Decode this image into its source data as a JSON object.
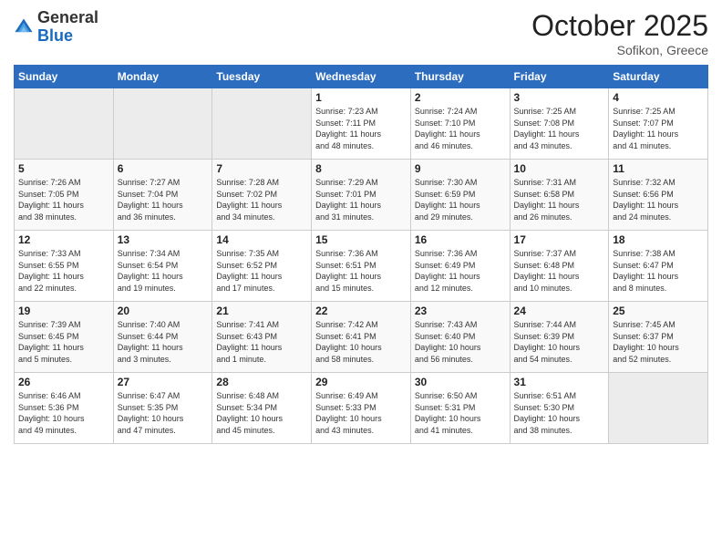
{
  "logo": {
    "general": "General",
    "blue": "Blue"
  },
  "header": {
    "month": "October 2025",
    "location": "Sofikon, Greece"
  },
  "days_of_week": [
    "Sunday",
    "Monday",
    "Tuesday",
    "Wednesday",
    "Thursday",
    "Friday",
    "Saturday"
  ],
  "weeks": [
    [
      {
        "day": "",
        "info": ""
      },
      {
        "day": "",
        "info": ""
      },
      {
        "day": "",
        "info": ""
      },
      {
        "day": "1",
        "info": "Sunrise: 7:23 AM\nSunset: 7:11 PM\nDaylight: 11 hours\nand 48 minutes."
      },
      {
        "day": "2",
        "info": "Sunrise: 7:24 AM\nSunset: 7:10 PM\nDaylight: 11 hours\nand 46 minutes."
      },
      {
        "day": "3",
        "info": "Sunrise: 7:25 AM\nSunset: 7:08 PM\nDaylight: 11 hours\nand 43 minutes."
      },
      {
        "day": "4",
        "info": "Sunrise: 7:25 AM\nSunset: 7:07 PM\nDaylight: 11 hours\nand 41 minutes."
      }
    ],
    [
      {
        "day": "5",
        "info": "Sunrise: 7:26 AM\nSunset: 7:05 PM\nDaylight: 11 hours\nand 38 minutes."
      },
      {
        "day": "6",
        "info": "Sunrise: 7:27 AM\nSunset: 7:04 PM\nDaylight: 11 hours\nand 36 minutes."
      },
      {
        "day": "7",
        "info": "Sunrise: 7:28 AM\nSunset: 7:02 PM\nDaylight: 11 hours\nand 34 minutes."
      },
      {
        "day": "8",
        "info": "Sunrise: 7:29 AM\nSunset: 7:01 PM\nDaylight: 11 hours\nand 31 minutes."
      },
      {
        "day": "9",
        "info": "Sunrise: 7:30 AM\nSunset: 6:59 PM\nDaylight: 11 hours\nand 29 minutes."
      },
      {
        "day": "10",
        "info": "Sunrise: 7:31 AM\nSunset: 6:58 PM\nDaylight: 11 hours\nand 26 minutes."
      },
      {
        "day": "11",
        "info": "Sunrise: 7:32 AM\nSunset: 6:56 PM\nDaylight: 11 hours\nand 24 minutes."
      }
    ],
    [
      {
        "day": "12",
        "info": "Sunrise: 7:33 AM\nSunset: 6:55 PM\nDaylight: 11 hours\nand 22 minutes."
      },
      {
        "day": "13",
        "info": "Sunrise: 7:34 AM\nSunset: 6:54 PM\nDaylight: 11 hours\nand 19 minutes."
      },
      {
        "day": "14",
        "info": "Sunrise: 7:35 AM\nSunset: 6:52 PM\nDaylight: 11 hours\nand 17 minutes."
      },
      {
        "day": "15",
        "info": "Sunrise: 7:36 AM\nSunset: 6:51 PM\nDaylight: 11 hours\nand 15 minutes."
      },
      {
        "day": "16",
        "info": "Sunrise: 7:36 AM\nSunset: 6:49 PM\nDaylight: 11 hours\nand 12 minutes."
      },
      {
        "day": "17",
        "info": "Sunrise: 7:37 AM\nSunset: 6:48 PM\nDaylight: 11 hours\nand 10 minutes."
      },
      {
        "day": "18",
        "info": "Sunrise: 7:38 AM\nSunset: 6:47 PM\nDaylight: 11 hours\nand 8 minutes."
      }
    ],
    [
      {
        "day": "19",
        "info": "Sunrise: 7:39 AM\nSunset: 6:45 PM\nDaylight: 11 hours\nand 5 minutes."
      },
      {
        "day": "20",
        "info": "Sunrise: 7:40 AM\nSunset: 6:44 PM\nDaylight: 11 hours\nand 3 minutes."
      },
      {
        "day": "21",
        "info": "Sunrise: 7:41 AM\nSunset: 6:43 PM\nDaylight: 11 hours\nand 1 minute."
      },
      {
        "day": "22",
        "info": "Sunrise: 7:42 AM\nSunset: 6:41 PM\nDaylight: 10 hours\nand 58 minutes."
      },
      {
        "day": "23",
        "info": "Sunrise: 7:43 AM\nSunset: 6:40 PM\nDaylight: 10 hours\nand 56 minutes."
      },
      {
        "day": "24",
        "info": "Sunrise: 7:44 AM\nSunset: 6:39 PM\nDaylight: 10 hours\nand 54 minutes."
      },
      {
        "day": "25",
        "info": "Sunrise: 7:45 AM\nSunset: 6:37 PM\nDaylight: 10 hours\nand 52 minutes."
      }
    ],
    [
      {
        "day": "26",
        "info": "Sunrise: 6:46 AM\nSunset: 5:36 PM\nDaylight: 10 hours\nand 49 minutes."
      },
      {
        "day": "27",
        "info": "Sunrise: 6:47 AM\nSunset: 5:35 PM\nDaylight: 10 hours\nand 47 minutes."
      },
      {
        "day": "28",
        "info": "Sunrise: 6:48 AM\nSunset: 5:34 PM\nDaylight: 10 hours\nand 45 minutes."
      },
      {
        "day": "29",
        "info": "Sunrise: 6:49 AM\nSunset: 5:33 PM\nDaylight: 10 hours\nand 43 minutes."
      },
      {
        "day": "30",
        "info": "Sunrise: 6:50 AM\nSunset: 5:31 PM\nDaylight: 10 hours\nand 41 minutes."
      },
      {
        "day": "31",
        "info": "Sunrise: 6:51 AM\nSunset: 5:30 PM\nDaylight: 10 hours\nand 38 minutes."
      },
      {
        "day": "",
        "info": ""
      }
    ]
  ]
}
